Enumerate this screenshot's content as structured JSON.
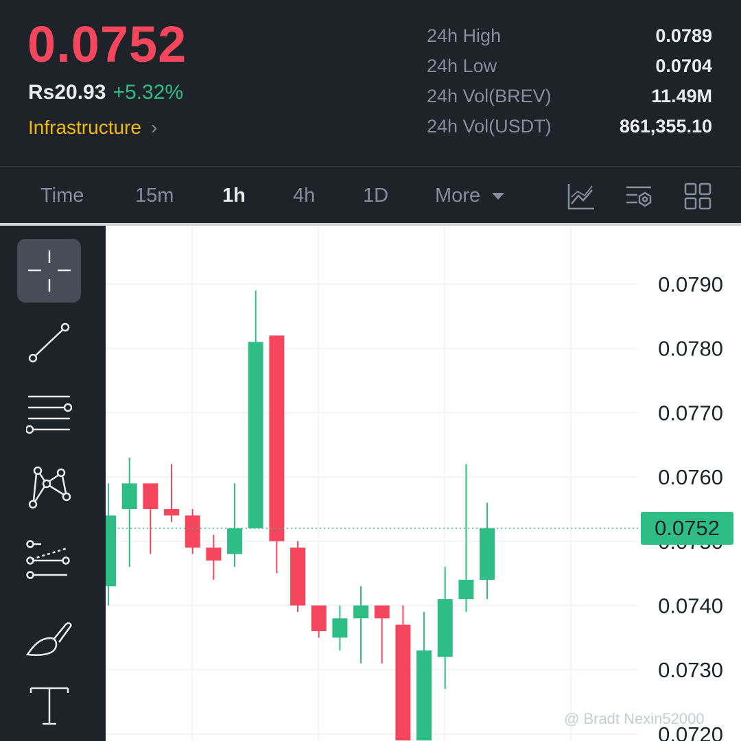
{
  "header": {
    "price": "0.0752",
    "fiat_price": "Rs20.93",
    "change_percent": "+5.32%",
    "tag": "Infrastructure",
    "stats": [
      {
        "label": "24h High",
        "value": "0.0789"
      },
      {
        "label": "24h Low",
        "value": "0.0704"
      },
      {
        "label": "24h Vol(BREV)",
        "value": "11.49M"
      },
      {
        "label": "24h Vol(USDT)",
        "value": "861,355.10"
      }
    ]
  },
  "tabs": {
    "items": [
      {
        "label": "Time",
        "active": false
      },
      {
        "label": "15m",
        "active": false
      },
      {
        "label": "1h",
        "active": true
      },
      {
        "label": "4h",
        "active": false
      },
      {
        "label": "1D",
        "active": false
      }
    ],
    "more_label": "More",
    "icons": [
      "indicator-icon",
      "settings-icon",
      "layout-grid-icon"
    ]
  },
  "toolbar": {
    "tools": [
      "crosshair-icon",
      "trend-line-icon",
      "horizontal-lines-icon",
      "pattern-icon",
      "fib-icon",
      "brush-icon",
      "text-tool-icon"
    ],
    "active_tool": "crosshair-icon"
  },
  "colors": {
    "up": "#2ebd85",
    "down": "#f6465d",
    "accent": "#f0b90b"
  },
  "chart_data": {
    "type": "candlestick",
    "y_ticks": [
      "0.0790",
      "0.0780",
      "0.0770",
      "0.0760",
      "0.0750",
      "0.0740",
      "0.0730",
      "0.0720"
    ],
    "current_price": "0.0752",
    "ylim": [
      0.0719,
      0.0798
    ],
    "candles": [
      {
        "o": 0.0743,
        "h": 0.0759,
        "l": 0.074,
        "c": 0.0754
      },
      {
        "o": 0.0755,
        "h": 0.0763,
        "l": 0.0746,
        "c": 0.0759
      },
      {
        "o": 0.0759,
        "h": 0.0759,
        "l": 0.0748,
        "c": 0.0755
      },
      {
        "o": 0.0755,
        "h": 0.0762,
        "l": 0.0753,
        "c": 0.0754
      },
      {
        "o": 0.0754,
        "h": 0.0755,
        "l": 0.0748,
        "c": 0.0749
      },
      {
        "o": 0.0749,
        "h": 0.0751,
        "l": 0.0744,
        "c": 0.0747
      },
      {
        "o": 0.0748,
        "h": 0.0759,
        "l": 0.0746,
        "c": 0.0752
      },
      {
        "o": 0.0752,
        "h": 0.0789,
        "l": 0.0752,
        "c": 0.0781
      },
      {
        "o": 0.0782,
        "h": 0.0782,
        "l": 0.0745,
        "c": 0.075
      },
      {
        "o": 0.0749,
        "h": 0.075,
        "l": 0.0739,
        "c": 0.074
      },
      {
        "o": 0.074,
        "h": 0.074,
        "l": 0.0735,
        "c": 0.0736
      },
      {
        "o": 0.0735,
        "h": 0.074,
        "l": 0.0733,
        "c": 0.0738
      },
      {
        "o": 0.0738,
        "h": 0.0743,
        "l": 0.0731,
        "c": 0.074
      },
      {
        "o": 0.074,
        "h": 0.074,
        "l": 0.0731,
        "c": 0.0738
      },
      {
        "o": 0.0737,
        "h": 0.074,
        "l": 0.0719,
        "c": 0.0719
      },
      {
        "o": 0.0719,
        "h": 0.0739,
        "l": 0.0719,
        "c": 0.0733
      },
      {
        "o": 0.0732,
        "h": 0.0746,
        "l": 0.0727,
        "c": 0.0741
      },
      {
        "o": 0.0741,
        "h": 0.0762,
        "l": 0.0739,
        "c": 0.0744
      },
      {
        "o": 0.0744,
        "h": 0.0756,
        "l": 0.0741,
        "c": 0.0752
      }
    ]
  },
  "watermark": "@ Bradt Nexin52000"
}
